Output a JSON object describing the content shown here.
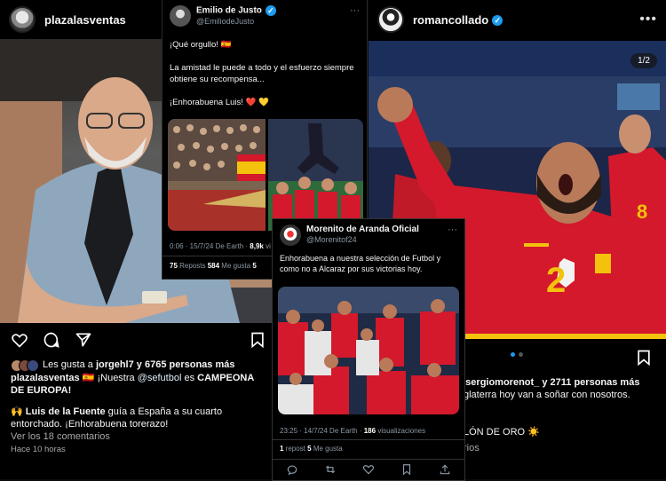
{
  "left_post": {
    "username": "plazalasventas",
    "likes_prefix": "Les gusta a ",
    "likes_user": "jorgehl7",
    "likes_suffix": " y 6765 personas más",
    "caption_user": "plazalasventas",
    "caption_text1": " 🇪🇸 ¡Nuestra ",
    "caption_mention": "@sefutbol",
    "caption_text2": " es ",
    "caption_bold": "CAMPEONA DE EUROPA!",
    "caption2_prefix": "🙌 ",
    "caption2_bold": "Luis de la Fuente",
    "caption2_text": " guía a España a su cuarto entorchado. ¡Enhorabuena torerazo!",
    "comments_link": "Ver los 18 comentarios",
    "time": "Hace 10 horas"
  },
  "tweet1": {
    "name": "Emilio de Justo",
    "handle": "@EmiliodeJusto",
    "line1": "¡Qué orgullo! 🇪🇸",
    "line2": "La amistad le puede a todo y el esfuerzo siempre obtiene su recompensa...",
    "line3": "¡Enhorabuena Luis! ❤️ 💛",
    "meta": "0:06 · 15/7/24 De Earth · ",
    "views": "8,9k",
    "views_label": " vi",
    "reposts": "75",
    "reposts_label": " Reposts ",
    "likes": "584",
    "likes_label": " Me gusta ",
    "extra": "5"
  },
  "tweet2": {
    "name": "Morenito de Aranda Oficial",
    "handle": "@Morenitof24",
    "text": "Enhorabuena a nuestra selección de Futbol y como no a Alcaraz por sus victorias hoy.",
    "meta": "23:25 · 14/7/24 De Earth · ",
    "views": "186",
    "views_label": " visualizaciones",
    "reposts": "1",
    "reposts_label": " repost ",
    "likes": "5",
    "likes_label": " Me gusta"
  },
  "right_post": {
    "username": "romancollado",
    "counter": "1/2",
    "likes_text": "a sergiomorenot_ y 2711 personas más",
    "caption_text": "glaterra hoy van a soñar con nosotros.",
    "caption2": "LÓN DE ORO ☀️",
    "comments": "rios",
    "jersey_number_1": "2",
    "jersey_number_2": "8"
  },
  "colors": {
    "accent": "#1d9bf0",
    "spain_red": "#d3192b",
    "spain_yellow": "#f4c20d"
  },
  "icons": [
    "heart-icon",
    "comment-icon",
    "share-icon",
    "bookmark-icon",
    "more-icon",
    "verified-icon",
    "reply-icon",
    "repost-icon",
    "like-icon",
    "views-icon",
    "upload-icon"
  ]
}
